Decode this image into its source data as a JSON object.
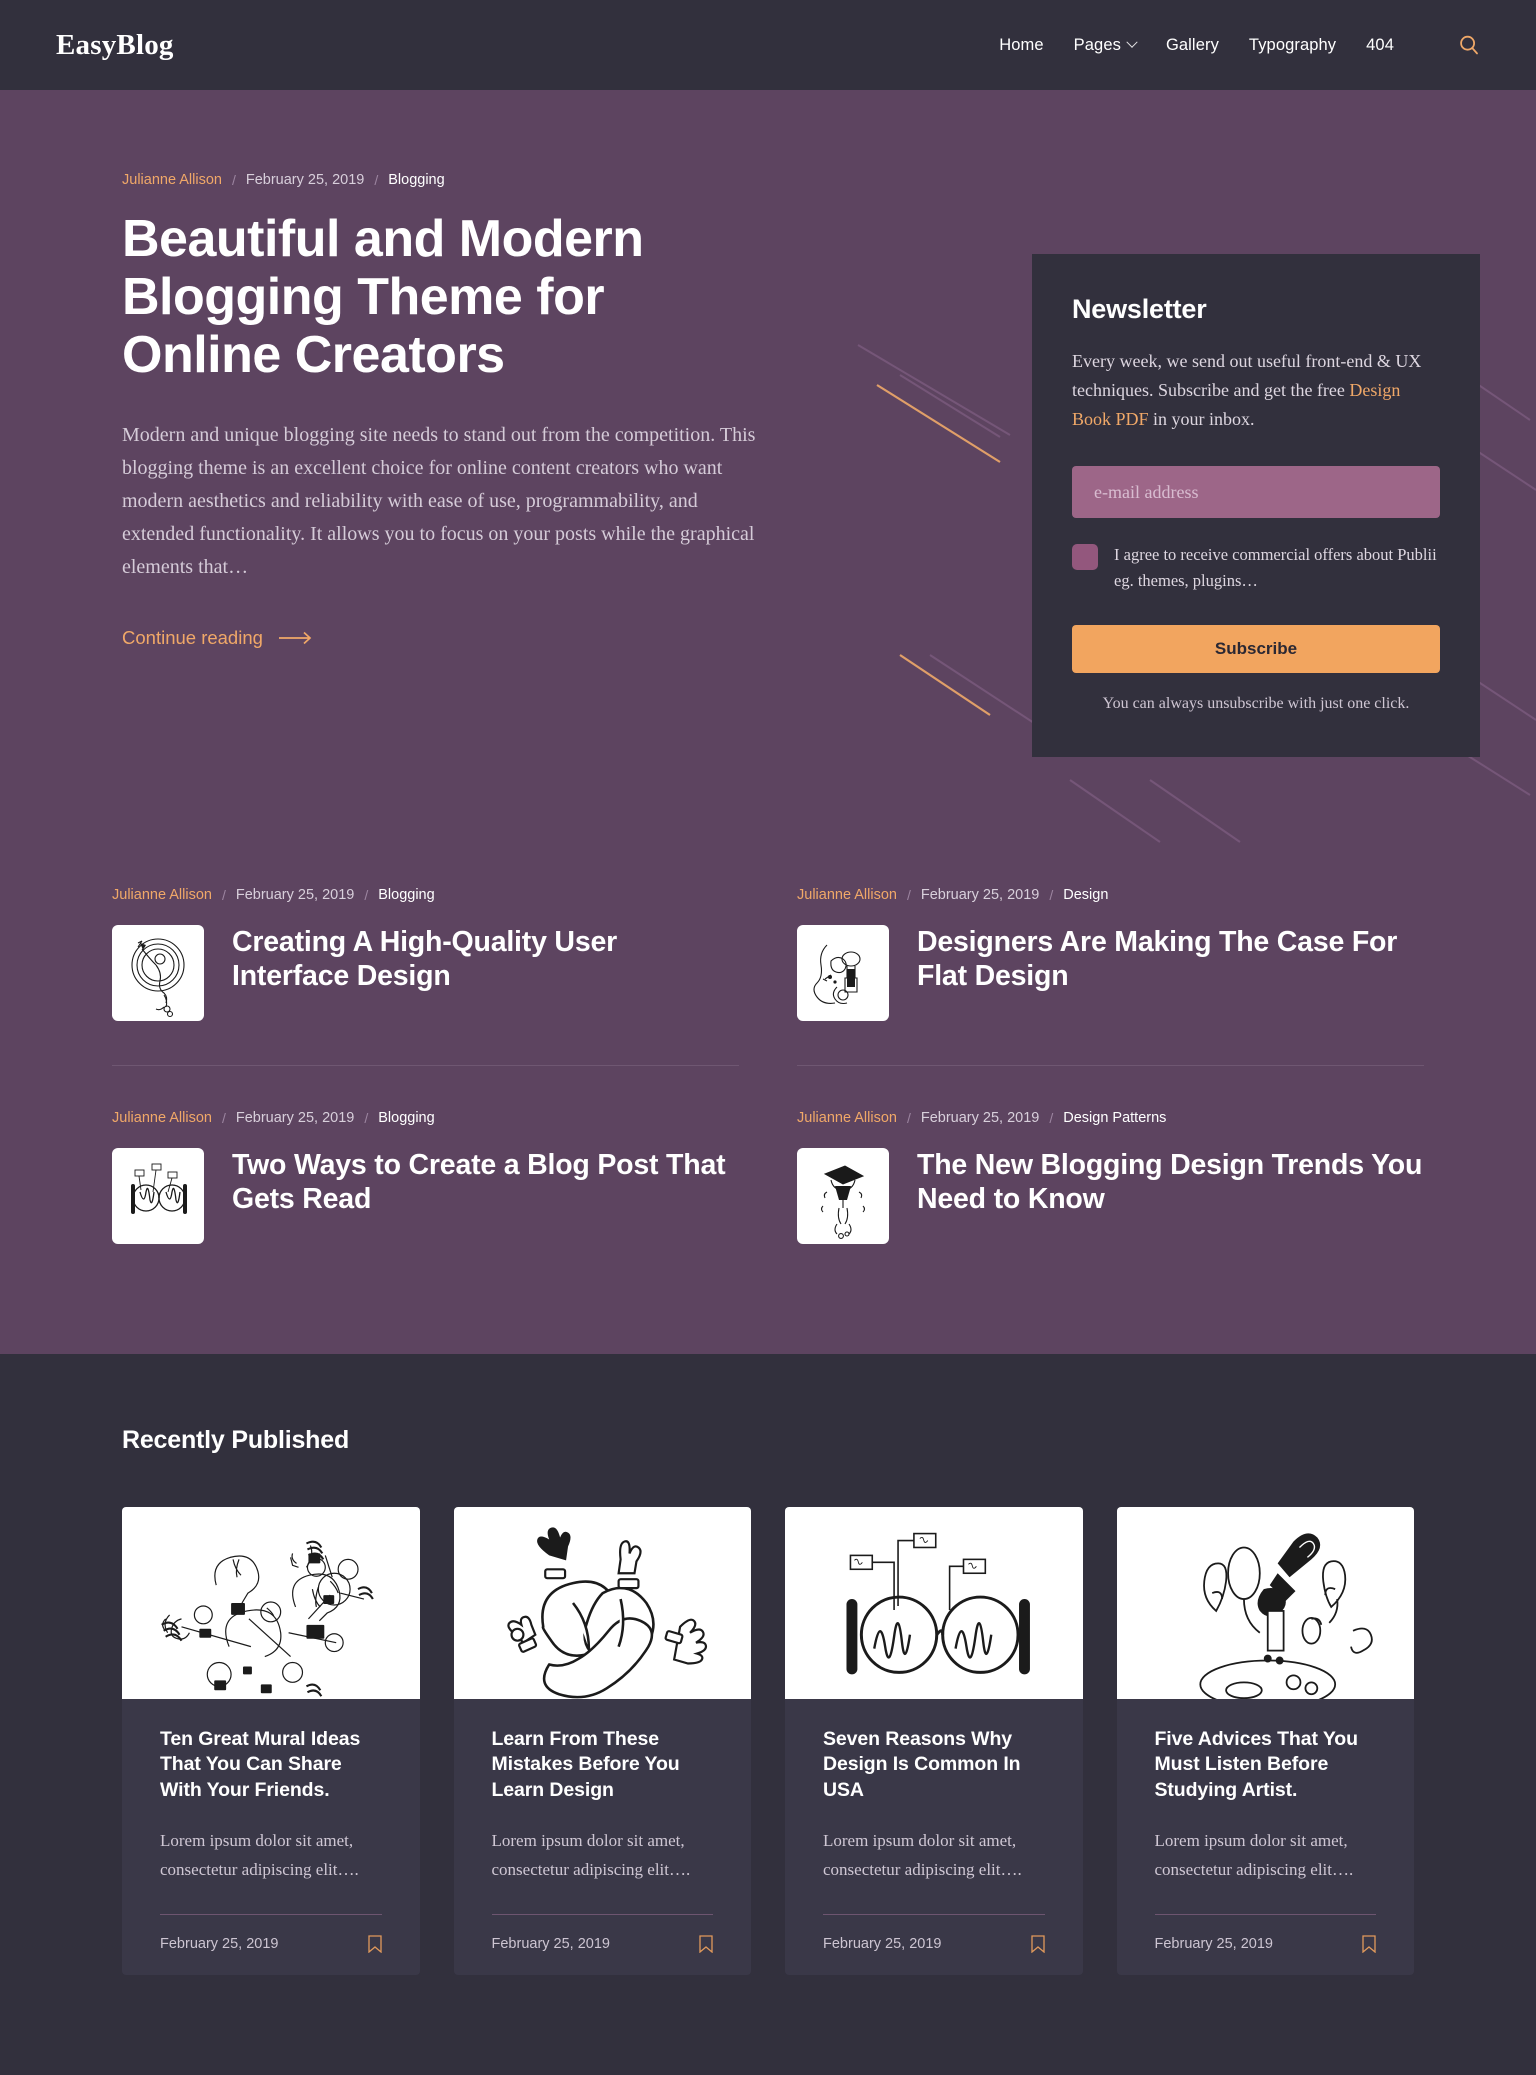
{
  "header": {
    "brand": "EasyBlog",
    "nav": [
      {
        "label": "Home",
        "dropdown": false
      },
      {
        "label": "Pages",
        "dropdown": true
      },
      {
        "label": "Gallery",
        "dropdown": false
      },
      {
        "label": "Typography",
        "dropdown": false
      },
      {
        "label": "404",
        "dropdown": false
      }
    ],
    "search_icon": "search-icon"
  },
  "hero": {
    "meta": {
      "author": "Julianne Allison",
      "separator": "/",
      "date": "February 25, 2019",
      "category": "Blogging"
    },
    "title": "Beautiful and Modern Blogging Theme for Online Creators",
    "excerpt": "Modern and unique blogging site needs to stand out from the competition. This blogging theme is an excellent choice for online content creators who want modern aesthetics and reliability with ease of use, programmability, and extended functionality. It allows you to focus on your posts while the graphical elements that…",
    "continue_label": "Continue reading"
  },
  "newsletter": {
    "title": "Newsletter",
    "text_before": "Every week, we send out useful front-end & UX techniques. Subscribe and get the free ",
    "text_link": "Design Book PDF",
    "text_after": " in your inbox.",
    "email_placeholder": "e-mail address",
    "email_value": "",
    "consent_label": "I agree to receive commercial offers about Publii eg. themes, plugins…",
    "consent_checked": false,
    "submit_label": "Subscribe",
    "footnote": "You can always unsubscribe with just one click."
  },
  "posts": [
    {
      "author": "Julianne Allison",
      "date": "February 25, 2019",
      "category": "Blogging",
      "title": "Creating A High-Quality User Interface Design",
      "thumb": "sketch-circle-figure"
    },
    {
      "author": "Julianne Allison",
      "date": "February 25, 2019",
      "category": "Design",
      "title": "Designers Are Making The Case For Flat Design",
      "thumb": "sketch-face-tools"
    },
    {
      "author": "Julianne Allison",
      "date": "February 25, 2019",
      "category": "Blogging",
      "title": "Two Ways to Create a Blog Post That Gets Read",
      "thumb": "sketch-glasses-small"
    },
    {
      "author": "Julianne Allison",
      "date": "February 25, 2019",
      "category": "Design Patterns",
      "title": "The New Blogging Design Trends You Need to Know",
      "thumb": "sketch-graduation-cap"
    }
  ],
  "recent": {
    "heading": "Recently Published",
    "cards": [
      {
        "title": "Ten Great Mural Ideas That You Can Share With Your Friends.",
        "excerpt": "Lorem ipsum dolor sit amet, consectetur adipiscing elit….",
        "date": "February 25, 2019",
        "image": "lightbulbs-illustration",
        "bookmark_icon": "bookmark-icon"
      },
      {
        "title": "Learn From These Mistakes Before You Learn Design",
        "excerpt": "Lorem ipsum dolor sit amet, consectetur adipiscing elit….",
        "date": "February 25, 2019",
        "image": "knot-hands-illustration",
        "bookmark_icon": "bookmark-icon"
      },
      {
        "title": "Seven Reasons Why Design Is Common In USA",
        "excerpt": "Lorem ipsum dolor sit amet, consectetur adipiscing elit….",
        "date": "February 25, 2019",
        "image": "glasses-illustration",
        "bookmark_icon": "bookmark-icon"
      },
      {
        "title": "Five Advices That You Must Listen Before Studying Artist.",
        "excerpt": "Lorem ipsum dolor sit amet, consectetur adipiscing elit….",
        "date": "February 25, 2019",
        "image": "paintbrush-palette-illustration",
        "bookmark_icon": "bookmark-icon"
      }
    ]
  },
  "colors": {
    "header_bg": "#32303d",
    "hero_bg": "#5d4460",
    "accent": "#f0a868",
    "card_bg": "#3a3848",
    "page_bg": "#32303d",
    "input_bg": "#9d6688",
    "button_bg": "#f2a55f"
  }
}
